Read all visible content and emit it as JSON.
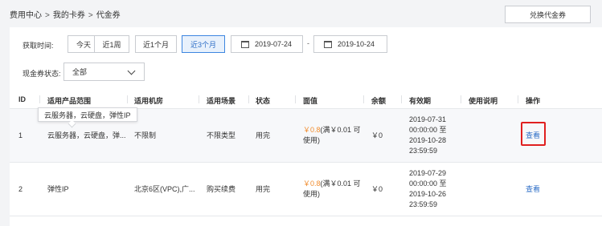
{
  "breadcrumb": {
    "items": [
      "费用中心",
      "我的卡券",
      "代金券"
    ],
    "separator": ">"
  },
  "redeem_button": "兑换代金券",
  "filters": {
    "time_label": "获取时间:",
    "ranges": [
      "今天",
      "近1周",
      "近1个月",
      "近3个月"
    ],
    "active_range": "近3个月",
    "start_date": "2019-07-24",
    "end_date": "2019-10-24",
    "date_separator": "-",
    "status_label": "现金券状态:",
    "status_value": "全部"
  },
  "table": {
    "headers": [
      "ID",
      "适用产品范围",
      "适用机房",
      "适用场景",
      "状态",
      "面值",
      "余额",
      "有效期",
      "使用说明",
      "操作"
    ],
    "rows": [
      {
        "id": "1",
        "products": "云服务器，云硬盘，弹...",
        "room": "不限制",
        "scene": "不限类型",
        "status": "用完",
        "value_amount": "￥0.8",
        "value_cond_1": "(满￥0.01 可",
        "value_cond_2": "使用)",
        "balance": "￥0",
        "validity": [
          "2019-07-31",
          "00:00:00 至",
          "2019-10-28",
          "23:59:59"
        ],
        "note": "",
        "action": "查看"
      },
      {
        "id": "2",
        "products": "弹性IP",
        "room": "北京6区(VPC),广...",
        "scene": "购买续费",
        "status": "用完",
        "value_amount": "￥0.8",
        "value_cond_1": "(满￥0.01 可",
        "value_cond_2": "使用)",
        "balance": "￥0",
        "validity": [
          "2019-07-29",
          "00:00:00 至",
          "2019-10-26",
          "23:59:59"
        ],
        "note": "",
        "action": "查看"
      }
    ]
  },
  "tooltip": "云服务器，云硬盘，弹性IP",
  "colors": {
    "accent": "#2f6fc7",
    "orange": "#f08c2e",
    "highlight": "#e02020"
  }
}
